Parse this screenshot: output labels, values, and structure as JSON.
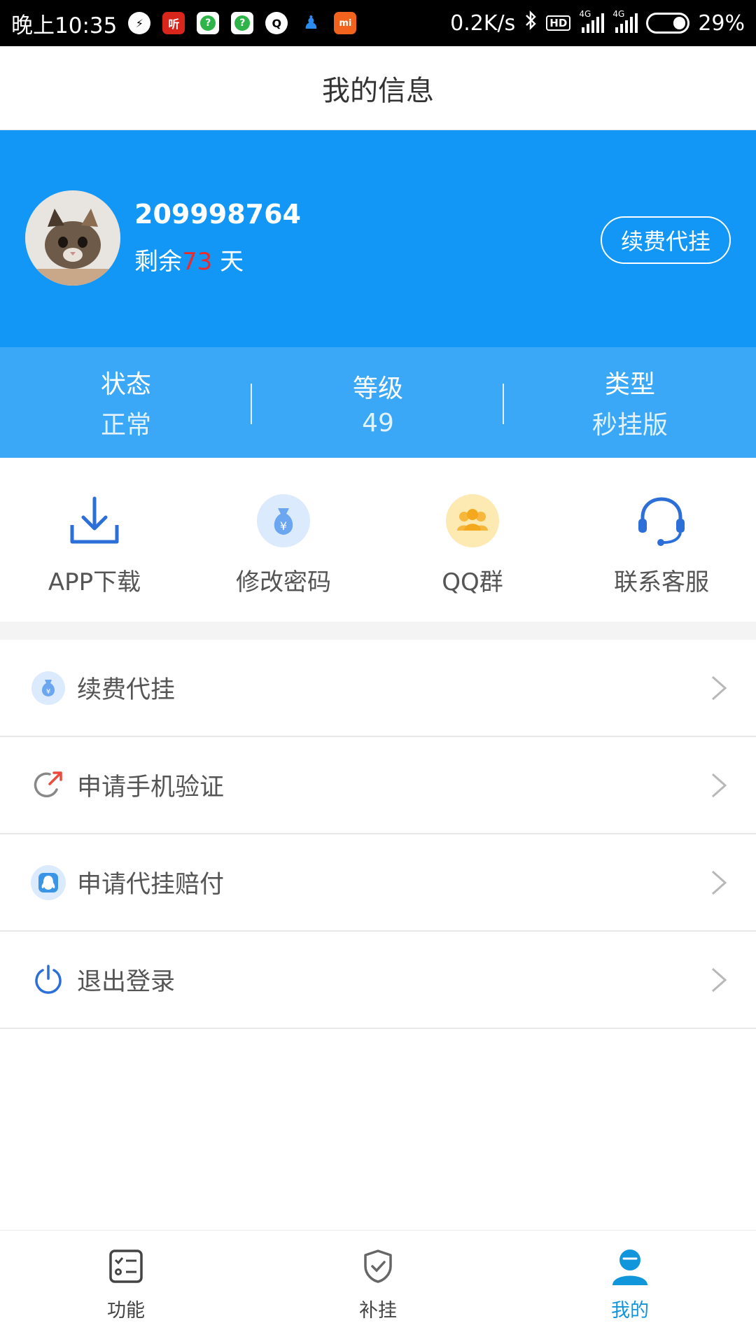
{
  "status_bar": {
    "time": "晚上10:35",
    "network_speed": "0.2K/s",
    "hd": "HD",
    "net1": "4G",
    "net2": "4G",
    "battery": "29%"
  },
  "header": {
    "title": "我的信息"
  },
  "profile": {
    "user_id": "209998764",
    "remaining_prefix": "剩余",
    "remaining_days": "73",
    "remaining_suffix": " 天",
    "renew_button": "续费代挂"
  },
  "stats": [
    {
      "label": "状态",
      "value": "正常"
    },
    {
      "label": "等级",
      "value": "49"
    },
    {
      "label": "类型",
      "value": "秒挂版"
    }
  ],
  "quick_actions": [
    {
      "label": "APP下载",
      "icon": "download-icon"
    },
    {
      "label": "修改密码",
      "icon": "money-bag-icon"
    },
    {
      "label": "QQ群",
      "icon": "group-icon"
    },
    {
      "label": "联系客服",
      "icon": "headset-icon"
    }
  ],
  "menu": [
    {
      "label": "续费代挂",
      "icon": "money-bag-icon"
    },
    {
      "label": "申请手机验证",
      "icon": "share-arrow-icon"
    },
    {
      "label": "申请代挂赔付",
      "icon": "qq-penguin-icon"
    },
    {
      "label": "退出登录",
      "icon": "power-icon"
    }
  ],
  "bottom_nav": [
    {
      "label": "功能",
      "icon": "checklist-icon"
    },
    {
      "label": "补挂",
      "icon": "shield-check-icon"
    },
    {
      "label": "我的",
      "icon": "user-icon",
      "active": true
    }
  ],
  "colors": {
    "primary": "#1297f6",
    "stats_bg": "#3aa8f6",
    "days_red": "#f02828",
    "active_nav": "#1296db"
  }
}
